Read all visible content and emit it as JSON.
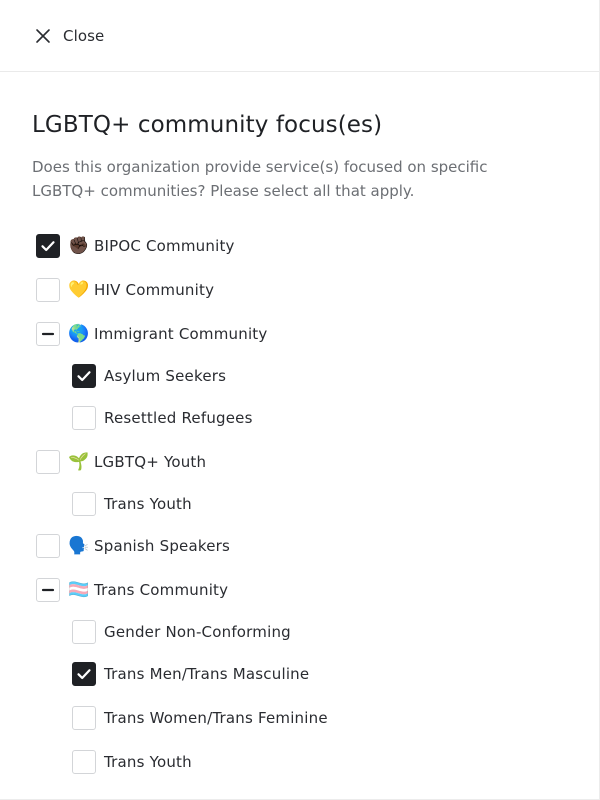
{
  "header": {
    "close_label": "Close"
  },
  "form": {
    "title": "LGBTQ+ community focus(es)",
    "description": "Does this organization provide service(s) focused on specific LGBTQ+ communities? Please select all that apply."
  },
  "options": [
    {
      "label": "BIPOC Community",
      "emoji": "✊🏿",
      "state": "checked"
    },
    {
      "label": "HIV Community",
      "emoji": "💛",
      "state": "unchecked"
    },
    {
      "label": "Immigrant Community",
      "emoji": "🌎",
      "state": "indeterminate"
    },
    {
      "label": "Asylum Seekers",
      "state": "checked"
    },
    {
      "label": "Resettled Refugees",
      "state": "unchecked"
    },
    {
      "label": "LGBTQ+ Youth",
      "emoji": "🌱",
      "state": "unchecked"
    },
    {
      "label": "Trans Youth",
      "state": "unchecked"
    },
    {
      "label": "Spanish Speakers",
      "emoji": "🗣️",
      "state": "unchecked"
    },
    {
      "label": "Trans Community",
      "emoji": "🏳️‍⚧️",
      "state": "indeterminate"
    },
    {
      "label": "Gender Non-Conforming",
      "state": "unchecked"
    },
    {
      "label": "Trans Men/Trans Masculine",
      "state": "checked"
    },
    {
      "label": "Trans Women/Trans Feminine",
      "state": "unchecked"
    },
    {
      "label": "Trans Youth",
      "state": "unchecked"
    }
  ],
  "colors": {
    "checked_fill": "#1f2125",
    "border": "#d3d5d8",
    "text": "#2a2c31",
    "muted": "#6c6f74"
  }
}
